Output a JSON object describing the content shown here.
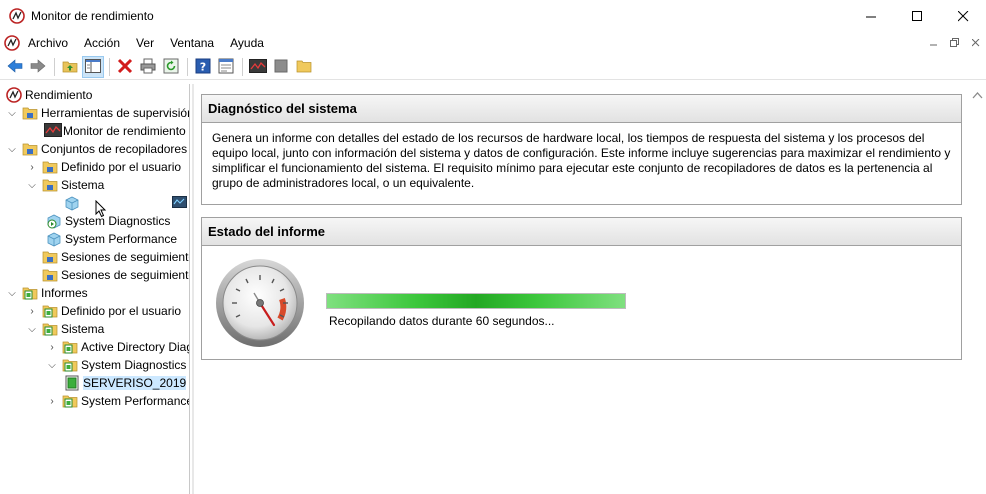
{
  "window": {
    "title": "Monitor de rendimiento",
    "minimize_glyph": "—",
    "maximize_glyph": "☐",
    "close_glyph": "✕"
  },
  "menu": {
    "items": [
      "Archivo",
      "Acción",
      "Ver",
      "Ventana",
      "Ayuda"
    ],
    "mdi": [
      "–",
      "🗗",
      "✕"
    ]
  },
  "toolbar": {
    "buttons": [
      "back-arrow-icon",
      "forward-arrow-icon",
      "up-folder-icon",
      "show-hide-tree-icon",
      "delete-icon",
      "print-icon",
      "refresh-icon",
      "help-icon",
      "properties-icon",
      "start-icon",
      "stop-icon",
      "new-folder-icon"
    ]
  },
  "tree": {
    "items": [
      {
        "label": "Rendimiento",
        "icon": "perfmon-icon",
        "chev": ""
      },
      {
        "label": "Herramientas de supervisión",
        "icon": "folder-icon",
        "chev": "⌵"
      },
      {
        "label": "Monitor de rendimiento",
        "icon": "monitor-graph-icon",
        "chev": ""
      },
      {
        "label": "Conjuntos de recopiladores",
        "icon": "folder-icon",
        "chev": "⌵"
      },
      {
        "label": "Definido por el usuario",
        "icon": "folder-icon",
        "chev": "›"
      },
      {
        "label": "Sistema",
        "icon": "folder-icon",
        "chev": "⌵"
      },
      {
        "label": "",
        "icon": "dataset-icon",
        "chev": ""
      },
      {
        "label": "System Diagnostics",
        "icon": "dataset-running-icon",
        "chev": ""
      },
      {
        "label": "System Performance",
        "icon": "dataset-icon",
        "chev": ""
      },
      {
        "label": "Sesiones de seguimiento",
        "icon": "folder-icon",
        "chev": ""
      },
      {
        "label": "Sesiones de seguimiento",
        "icon": "folder-icon",
        "chev": ""
      },
      {
        "label": "Informes",
        "icon": "reports-folder-icon",
        "chev": "⌵"
      },
      {
        "label": "Definido por el usuario",
        "icon": "reports-folder-icon",
        "chev": "›"
      },
      {
        "label": "Sistema",
        "icon": "reports-folder-icon",
        "chev": "⌵"
      },
      {
        "label": "Active Directory Diagnostics",
        "icon": "reports-folder-icon",
        "chev": "›"
      },
      {
        "label": "System Diagnostics",
        "icon": "reports-folder-icon",
        "chev": "⌵"
      },
      {
        "label": "SERVERISO_2019",
        "icon": "report-icon",
        "chev": ""
      },
      {
        "label": "System Performance",
        "icon": "reports-folder-icon",
        "chev": "›"
      }
    ]
  },
  "diagnostic_panel": {
    "title": "Diagnóstico del sistema",
    "description": "Genera un informe con detalles del estado de los recursos de hardware local, los tiempos de respuesta del sistema y los procesos del equipo local, junto con información del sistema y datos de configuración. Este informe incluye sugerencias para maximizar el rendimiento y simplificar el funcionamiento del sistema. El requisito mínimo para ejecutar este conjunto de recopiladores de datos es la pertenencia al grupo de administradores local, o un equivalente."
  },
  "status_panel": {
    "title": "Estado del informe",
    "progress_percent": 100,
    "status_text": "Recopilando datos durante 60 segundos..."
  },
  "colors": {
    "accent_selection": "#cce8ff",
    "progress_green": "#23a823",
    "panel_header": "#e2e2e2"
  }
}
